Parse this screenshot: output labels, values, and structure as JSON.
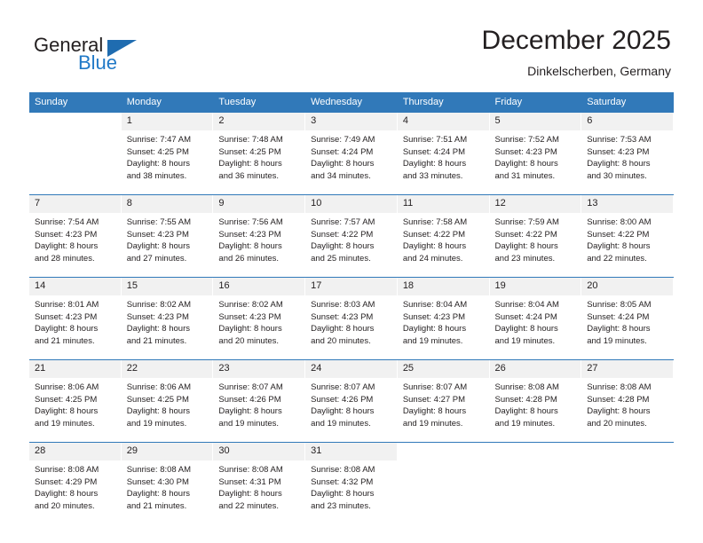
{
  "brand": {
    "name_part1": "General",
    "name_part2": "Blue",
    "accent_color": "#2079c7",
    "triangle_color": "#1f6cb0"
  },
  "header": {
    "title": "December 2025",
    "subtitle": "Dinkelscherben, Germany"
  },
  "theme": {
    "header_bg": "#3179b9",
    "daynum_bg": "#f1f1f1",
    "text_color": "#231f20"
  },
  "weekday_headers": [
    "Sunday",
    "Monday",
    "Tuesday",
    "Wednesday",
    "Thursday",
    "Friday",
    "Saturday"
  ],
  "weeks": [
    [
      {
        "day": "",
        "sunrise": "",
        "sunset": "",
        "daylight_line1": "",
        "daylight_line2": "",
        "empty": true
      },
      {
        "day": "1",
        "sunrise": "Sunrise: 7:47 AM",
        "sunset": "Sunset: 4:25 PM",
        "daylight_line1": "Daylight: 8 hours",
        "daylight_line2": "and 38 minutes.",
        "empty": false
      },
      {
        "day": "2",
        "sunrise": "Sunrise: 7:48 AM",
        "sunset": "Sunset: 4:25 PM",
        "daylight_line1": "Daylight: 8 hours",
        "daylight_line2": "and 36 minutes.",
        "empty": false
      },
      {
        "day": "3",
        "sunrise": "Sunrise: 7:49 AM",
        "sunset": "Sunset: 4:24 PM",
        "daylight_line1": "Daylight: 8 hours",
        "daylight_line2": "and 34 minutes.",
        "empty": false
      },
      {
        "day": "4",
        "sunrise": "Sunrise: 7:51 AM",
        "sunset": "Sunset: 4:24 PM",
        "daylight_line1": "Daylight: 8 hours",
        "daylight_line2": "and 33 minutes.",
        "empty": false
      },
      {
        "day": "5",
        "sunrise": "Sunrise: 7:52 AM",
        "sunset": "Sunset: 4:23 PM",
        "daylight_line1": "Daylight: 8 hours",
        "daylight_line2": "and 31 minutes.",
        "empty": false
      },
      {
        "day": "6",
        "sunrise": "Sunrise: 7:53 AM",
        "sunset": "Sunset: 4:23 PM",
        "daylight_line1": "Daylight: 8 hours",
        "daylight_line2": "and 30 minutes.",
        "empty": false
      }
    ],
    [
      {
        "day": "7",
        "sunrise": "Sunrise: 7:54 AM",
        "sunset": "Sunset: 4:23 PM",
        "daylight_line1": "Daylight: 8 hours",
        "daylight_line2": "and 28 minutes.",
        "empty": false
      },
      {
        "day": "8",
        "sunrise": "Sunrise: 7:55 AM",
        "sunset": "Sunset: 4:23 PM",
        "daylight_line1": "Daylight: 8 hours",
        "daylight_line2": "and 27 minutes.",
        "empty": false
      },
      {
        "day": "9",
        "sunrise": "Sunrise: 7:56 AM",
        "sunset": "Sunset: 4:23 PM",
        "daylight_line1": "Daylight: 8 hours",
        "daylight_line2": "and 26 minutes.",
        "empty": false
      },
      {
        "day": "10",
        "sunrise": "Sunrise: 7:57 AM",
        "sunset": "Sunset: 4:22 PM",
        "daylight_line1": "Daylight: 8 hours",
        "daylight_line2": "and 25 minutes.",
        "empty": false
      },
      {
        "day": "11",
        "sunrise": "Sunrise: 7:58 AM",
        "sunset": "Sunset: 4:22 PM",
        "daylight_line1": "Daylight: 8 hours",
        "daylight_line2": "and 24 minutes.",
        "empty": false
      },
      {
        "day": "12",
        "sunrise": "Sunrise: 7:59 AM",
        "sunset": "Sunset: 4:22 PM",
        "daylight_line1": "Daylight: 8 hours",
        "daylight_line2": "and 23 minutes.",
        "empty": false
      },
      {
        "day": "13",
        "sunrise": "Sunrise: 8:00 AM",
        "sunset": "Sunset: 4:22 PM",
        "daylight_line1": "Daylight: 8 hours",
        "daylight_line2": "and 22 minutes.",
        "empty": false
      }
    ],
    [
      {
        "day": "14",
        "sunrise": "Sunrise: 8:01 AM",
        "sunset": "Sunset: 4:23 PM",
        "daylight_line1": "Daylight: 8 hours",
        "daylight_line2": "and 21 minutes.",
        "empty": false
      },
      {
        "day": "15",
        "sunrise": "Sunrise: 8:02 AM",
        "sunset": "Sunset: 4:23 PM",
        "daylight_line1": "Daylight: 8 hours",
        "daylight_line2": "and 21 minutes.",
        "empty": false
      },
      {
        "day": "16",
        "sunrise": "Sunrise: 8:02 AM",
        "sunset": "Sunset: 4:23 PM",
        "daylight_line1": "Daylight: 8 hours",
        "daylight_line2": "and 20 minutes.",
        "empty": false
      },
      {
        "day": "17",
        "sunrise": "Sunrise: 8:03 AM",
        "sunset": "Sunset: 4:23 PM",
        "daylight_line1": "Daylight: 8 hours",
        "daylight_line2": "and 20 minutes.",
        "empty": false
      },
      {
        "day": "18",
        "sunrise": "Sunrise: 8:04 AM",
        "sunset": "Sunset: 4:23 PM",
        "daylight_line1": "Daylight: 8 hours",
        "daylight_line2": "and 19 minutes.",
        "empty": false
      },
      {
        "day": "19",
        "sunrise": "Sunrise: 8:04 AM",
        "sunset": "Sunset: 4:24 PM",
        "daylight_line1": "Daylight: 8 hours",
        "daylight_line2": "and 19 minutes.",
        "empty": false
      },
      {
        "day": "20",
        "sunrise": "Sunrise: 8:05 AM",
        "sunset": "Sunset: 4:24 PM",
        "daylight_line1": "Daylight: 8 hours",
        "daylight_line2": "and 19 minutes.",
        "empty": false
      }
    ],
    [
      {
        "day": "21",
        "sunrise": "Sunrise: 8:06 AM",
        "sunset": "Sunset: 4:25 PM",
        "daylight_line1": "Daylight: 8 hours",
        "daylight_line2": "and 19 minutes.",
        "empty": false
      },
      {
        "day": "22",
        "sunrise": "Sunrise: 8:06 AM",
        "sunset": "Sunset: 4:25 PM",
        "daylight_line1": "Daylight: 8 hours",
        "daylight_line2": "and 19 minutes.",
        "empty": false
      },
      {
        "day": "23",
        "sunrise": "Sunrise: 8:07 AM",
        "sunset": "Sunset: 4:26 PM",
        "daylight_line1": "Daylight: 8 hours",
        "daylight_line2": "and 19 minutes.",
        "empty": false
      },
      {
        "day": "24",
        "sunrise": "Sunrise: 8:07 AM",
        "sunset": "Sunset: 4:26 PM",
        "daylight_line1": "Daylight: 8 hours",
        "daylight_line2": "and 19 minutes.",
        "empty": false
      },
      {
        "day": "25",
        "sunrise": "Sunrise: 8:07 AM",
        "sunset": "Sunset: 4:27 PM",
        "daylight_line1": "Daylight: 8 hours",
        "daylight_line2": "and 19 minutes.",
        "empty": false
      },
      {
        "day": "26",
        "sunrise": "Sunrise: 8:08 AM",
        "sunset": "Sunset: 4:28 PM",
        "daylight_line1": "Daylight: 8 hours",
        "daylight_line2": "and 19 minutes.",
        "empty": false
      },
      {
        "day": "27",
        "sunrise": "Sunrise: 8:08 AM",
        "sunset": "Sunset: 4:28 PM",
        "daylight_line1": "Daylight: 8 hours",
        "daylight_line2": "and 20 minutes.",
        "empty": false
      }
    ],
    [
      {
        "day": "28",
        "sunrise": "Sunrise: 8:08 AM",
        "sunset": "Sunset: 4:29 PM",
        "daylight_line1": "Daylight: 8 hours",
        "daylight_line2": "and 20 minutes.",
        "empty": false
      },
      {
        "day": "29",
        "sunrise": "Sunrise: 8:08 AM",
        "sunset": "Sunset: 4:30 PM",
        "daylight_line1": "Daylight: 8 hours",
        "daylight_line2": "and 21 minutes.",
        "empty": false
      },
      {
        "day": "30",
        "sunrise": "Sunrise: 8:08 AM",
        "sunset": "Sunset: 4:31 PM",
        "daylight_line1": "Daylight: 8 hours",
        "daylight_line2": "and 22 minutes.",
        "empty": false
      },
      {
        "day": "31",
        "sunrise": "Sunrise: 8:08 AM",
        "sunset": "Sunset: 4:32 PM",
        "daylight_line1": "Daylight: 8 hours",
        "daylight_line2": "and 23 minutes.",
        "empty": false
      },
      {
        "day": "",
        "sunrise": "",
        "sunset": "",
        "daylight_line1": "",
        "daylight_line2": "",
        "empty": true
      },
      {
        "day": "",
        "sunrise": "",
        "sunset": "",
        "daylight_line1": "",
        "daylight_line2": "",
        "empty": true
      },
      {
        "day": "",
        "sunrise": "",
        "sunset": "",
        "daylight_line1": "",
        "daylight_line2": "",
        "empty": true
      }
    ]
  ]
}
